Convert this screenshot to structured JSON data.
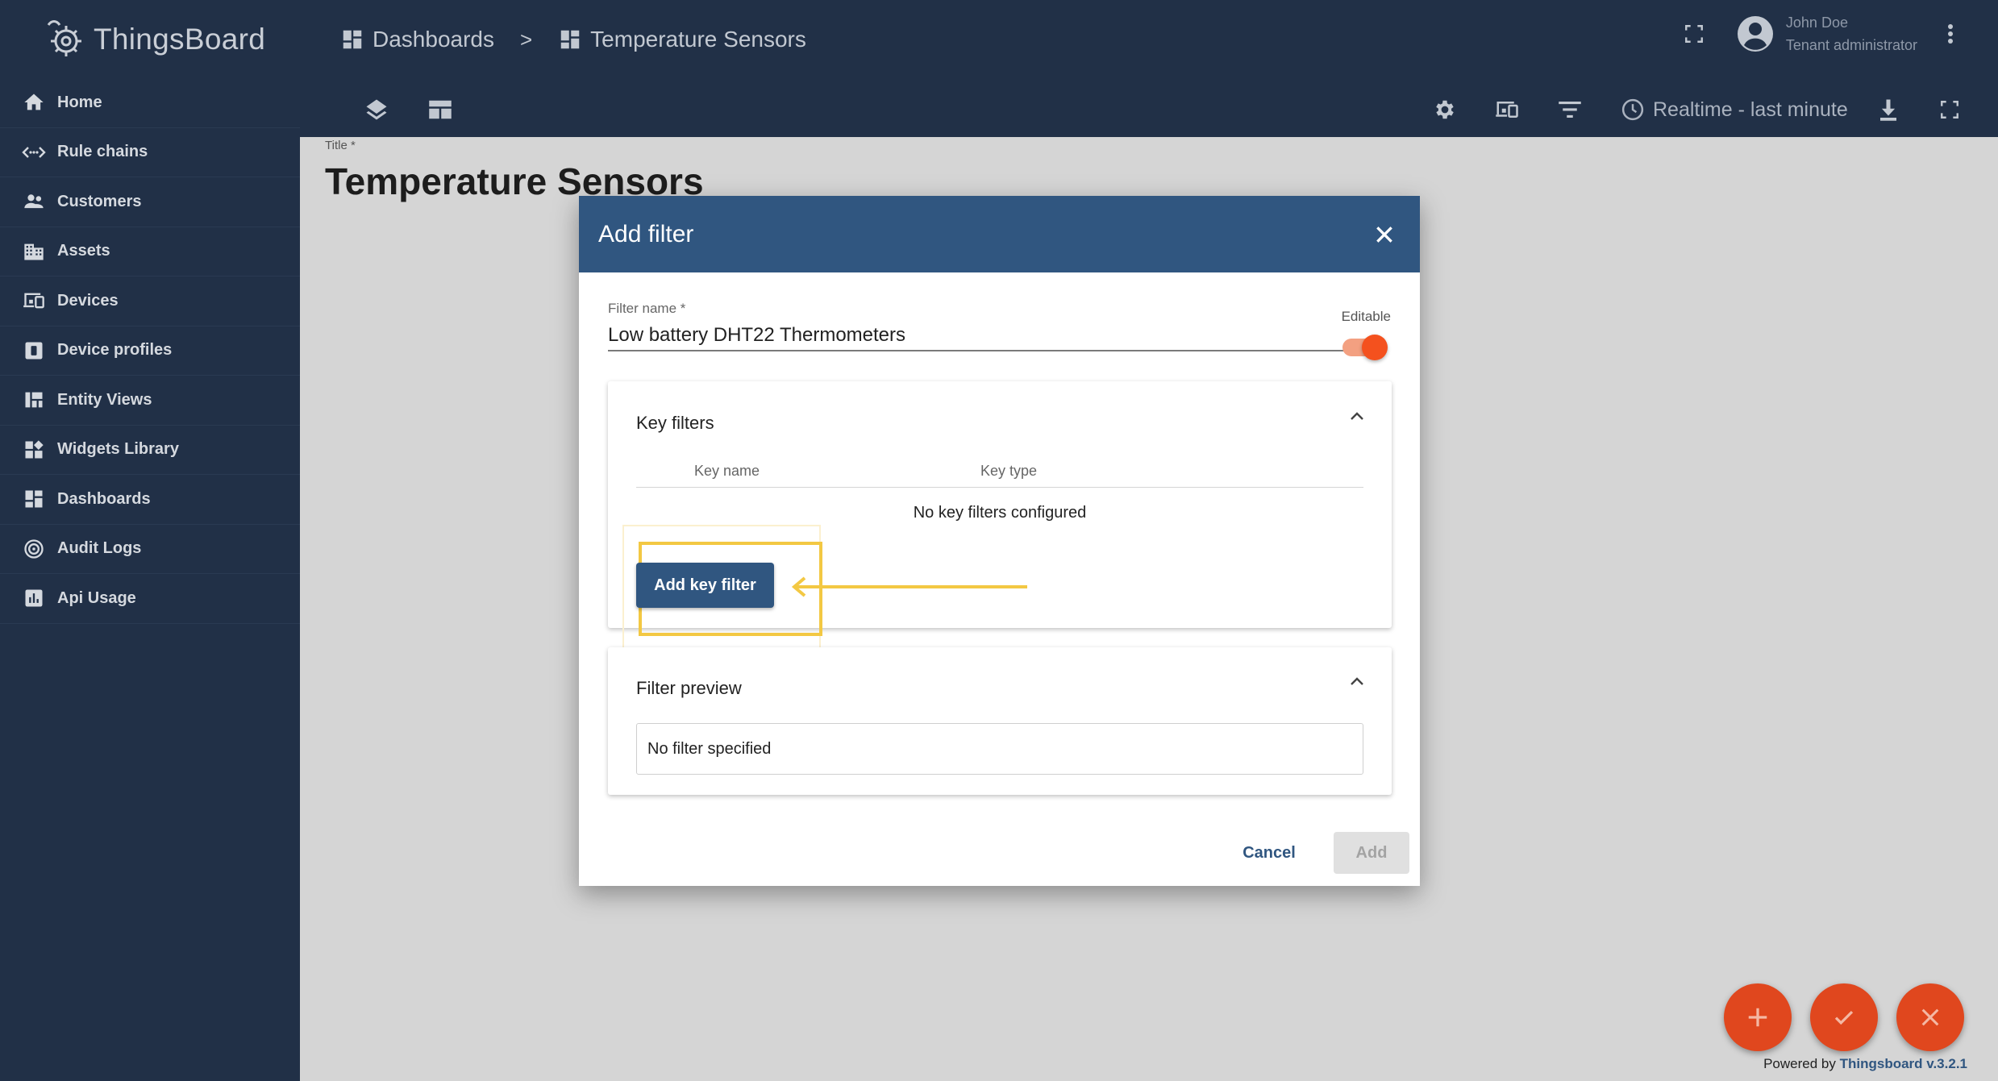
{
  "app": {
    "name": "ThingsBoard"
  },
  "sidebar": {
    "items": [
      {
        "label": "Home",
        "icon": "home-icon"
      },
      {
        "label": "Rule chains",
        "icon": "rule-chains-icon"
      },
      {
        "label": "Customers",
        "icon": "customers-icon"
      },
      {
        "label": "Assets",
        "icon": "assets-icon"
      },
      {
        "label": "Devices",
        "icon": "devices-icon"
      },
      {
        "label": "Device profiles",
        "icon": "device-profiles-icon"
      },
      {
        "label": "Entity Views",
        "icon": "entity-views-icon"
      },
      {
        "label": "Widgets Library",
        "icon": "widgets-library-icon"
      },
      {
        "label": "Dashboards",
        "icon": "dashboards-icon"
      },
      {
        "label": "Audit Logs",
        "icon": "audit-logs-icon"
      },
      {
        "label": "Api Usage",
        "icon": "api-usage-icon"
      }
    ]
  },
  "header": {
    "breadcrumb": {
      "parent": "Dashboards",
      "separator": ">",
      "current": "Temperature Sensors"
    },
    "user": {
      "name": "John Doe",
      "role": "Tenant administrator"
    },
    "realtime_label": "Realtime - last minute"
  },
  "main": {
    "title_label": "Title *",
    "title_value": "Temperature Sensors"
  },
  "dialog": {
    "title": "Add filter",
    "filter_name_label": "Filter name *",
    "filter_name_value": "Low battery DHT22 Thermometers",
    "editable_label": "Editable",
    "editable_on": true,
    "key_filters": {
      "title": "Key filters",
      "columns": [
        "Key name",
        "Key type"
      ],
      "empty_text": "No key filters configured",
      "add_button": "Add key filter"
    },
    "filter_preview": {
      "title": "Filter preview",
      "text": "No filter specified"
    },
    "cancel_label": "Cancel",
    "add_label": "Add"
  },
  "footer": {
    "powered_prefix": "Powered by",
    "powered_link": "Thingsboard v.3.2.1"
  },
  "colors": {
    "sidebar_bg": "#213047",
    "dialog_header": "#305680",
    "accent_orange": "#f4511e",
    "highlight_yellow": "#f3c843"
  }
}
